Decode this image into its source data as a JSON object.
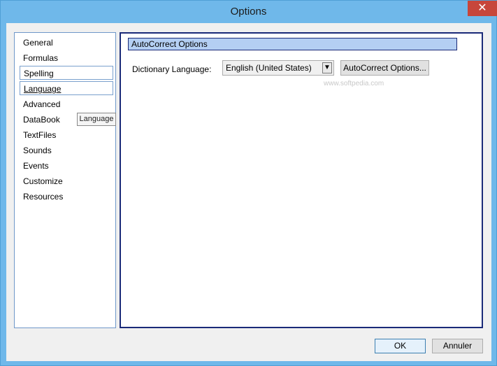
{
  "window": {
    "title": "Options",
    "close_glyph": "✕"
  },
  "nav": {
    "items": [
      {
        "label": "General"
      },
      {
        "label": "Formulas"
      },
      {
        "label": "Spelling"
      },
      {
        "label": "Language"
      },
      {
        "label": "Advanced"
      },
      {
        "label": "DataBook"
      },
      {
        "label": "TextFiles"
      },
      {
        "label": "Sounds"
      },
      {
        "label": "Events"
      },
      {
        "label": "Customize"
      },
      {
        "label": "Resources"
      }
    ],
    "selected": "Language",
    "tooltip": "Language"
  },
  "content": {
    "section_title": "AutoCorrect Options",
    "dictionary_label": "Dictionary Language:",
    "dictionary_value": "English (United States)",
    "autocorrect_button": "AutoCorrect Options..."
  },
  "watermark": "www.softpedia.com",
  "footer": {
    "ok": "OK",
    "cancel": "Annuler"
  }
}
